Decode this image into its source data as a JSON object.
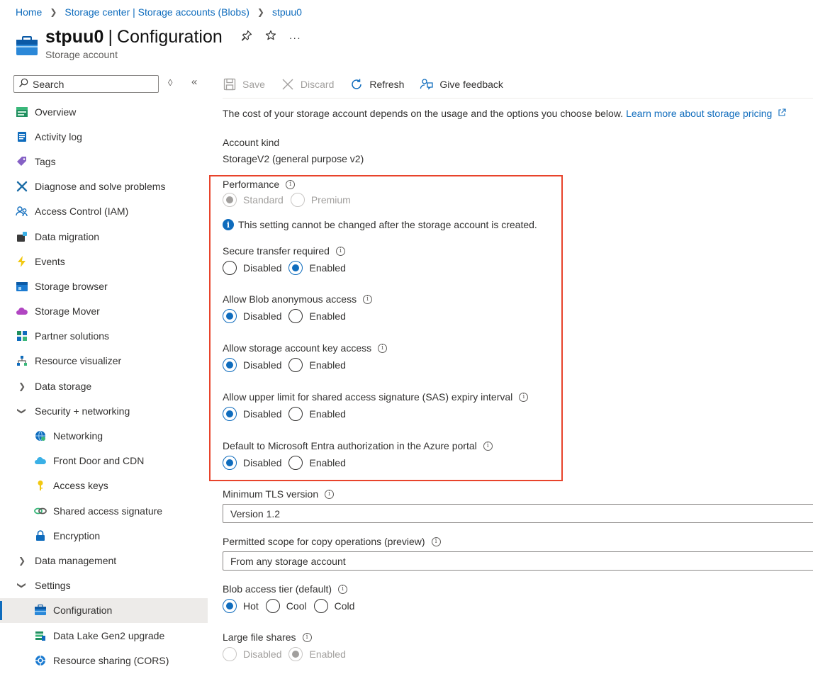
{
  "breadcrumb": {
    "items": [
      "Home",
      "Storage center | Storage accounts (Blobs)",
      "stpuu0"
    ]
  },
  "header": {
    "resource_name": "stpuu0",
    "separator": "|",
    "page_name": "Configuration",
    "resource_type": "Storage account",
    "actions": [
      "pin-icon",
      "star-icon",
      "more-icon"
    ]
  },
  "sidebar": {
    "search_placeholder": "Search",
    "items": [
      {
        "label": "Overview",
        "icon": "overview-icon"
      },
      {
        "label": "Activity log",
        "icon": "activity-log-icon"
      },
      {
        "label": "Tags",
        "icon": "tag-icon"
      },
      {
        "label": "Diagnose and solve problems",
        "icon": "wrench-icon"
      },
      {
        "label": "Access Control (IAM)",
        "icon": "people-icon"
      },
      {
        "label": "Data migration",
        "icon": "migration-icon"
      },
      {
        "label": "Events",
        "icon": "lightning-icon"
      },
      {
        "label": "Storage browser",
        "icon": "storage-browser-icon"
      },
      {
        "label": "Storage Mover",
        "icon": "cloud-icon"
      },
      {
        "label": "Partner solutions",
        "icon": "partner-icon"
      },
      {
        "label": "Resource visualizer",
        "icon": "visualizer-icon"
      },
      {
        "label": "Data storage",
        "icon": "chevron-right-icon"
      },
      {
        "label": "Security + networking",
        "icon": "chevron-down-icon"
      },
      {
        "label": "Networking",
        "icon": "globe-icon"
      },
      {
        "label": "Front Door and CDN",
        "icon": "cloud-cdn-icon"
      },
      {
        "label": "Access keys",
        "icon": "key-icon"
      },
      {
        "label": "Shared access signature",
        "icon": "link-icon"
      },
      {
        "label": "Encryption",
        "icon": "lock-icon"
      },
      {
        "label": "Data management",
        "icon": "chevron-right-icon"
      },
      {
        "label": "Settings",
        "icon": "chevron-down-icon"
      },
      {
        "label": "Configuration",
        "icon": "config-icon"
      },
      {
        "label": "Data Lake Gen2 upgrade",
        "icon": "upgrade-icon"
      },
      {
        "label": "Resource sharing (CORS)",
        "icon": "cors-icon"
      }
    ]
  },
  "toolbar": {
    "save": "Save",
    "discard": "Discard",
    "refresh": "Refresh",
    "feedback": "Give feedback"
  },
  "main": {
    "intro": "The cost of your storage account depends on the usage and the options you choose below.",
    "intro_link": "Learn more about storage pricing",
    "account_kind_label": "Account kind",
    "account_kind_value": "StorageV2 (general purpose v2)",
    "performance_label": "Performance",
    "performance_options": [
      "Standard",
      "Premium"
    ],
    "performance_notice": "This setting cannot be changed after the storage account is created.",
    "secure_transfer_label": "Secure transfer required",
    "blob_anon_label": "Allow Blob anonymous access",
    "key_access_label": "Allow storage account key access",
    "sas_label": "Allow upper limit for shared access signature (SAS) expiry interval",
    "entra_label": "Default to Microsoft Entra authorization in the Azure portal",
    "disabled": "Disabled",
    "enabled": "Enabled",
    "tls_label": "Minimum TLS version",
    "tls_value": "Version 1.2",
    "copy_scope_label": "Permitted scope for copy operations (preview)",
    "copy_scope_value": "From any storage account",
    "tier_label": "Blob access tier (default)",
    "tier_options": [
      "Hot",
      "Cool",
      "Cold"
    ],
    "large_file_label": "Large file shares"
  },
  "colors": {
    "accent": "#0f6cbd",
    "highlight_border": "#e8432b"
  }
}
